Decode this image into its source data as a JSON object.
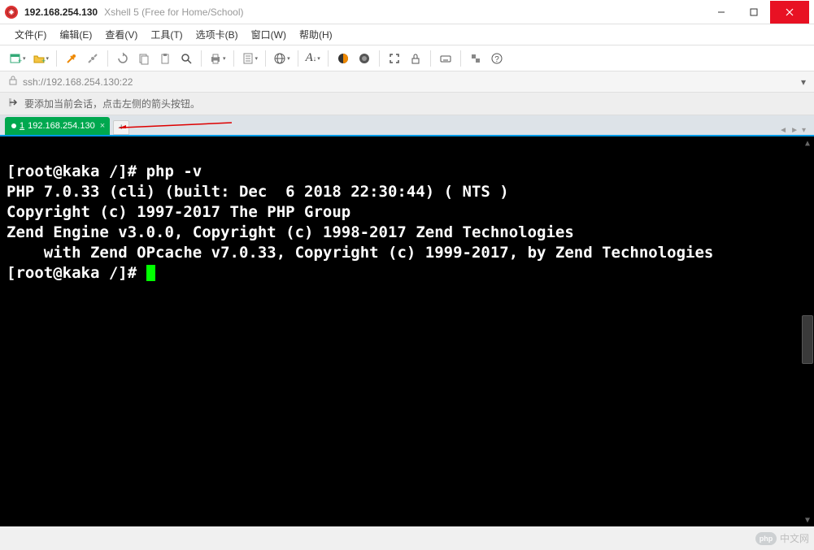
{
  "titlebar": {
    "host": "192.168.254.130",
    "app": "Xshell 5 (Free for Home/School)"
  },
  "menubar": [
    {
      "label": "文件(F)"
    },
    {
      "label": "编辑(E)"
    },
    {
      "label": "查看(V)"
    },
    {
      "label": "工具(T)"
    },
    {
      "label": "选项卡(B)"
    },
    {
      "label": "窗口(W)"
    },
    {
      "label": "帮助(H)"
    }
  ],
  "address": {
    "url": "ssh://192.168.254.130:22"
  },
  "hint": {
    "text": "要添加当前会话，点击左侧的箭头按钮。"
  },
  "tabs": {
    "items": [
      {
        "num": "1",
        "label": "192.168.254.130"
      }
    ]
  },
  "terminal": {
    "lines": [
      "[root@kaka /]# php -v",
      "PHP 7.0.33 (cli) (built: Dec  6 2018 22:30:44) ( NTS )",
      "Copyright (c) 1997-2017 The PHP Group",
      "Zend Engine v3.0.0, Copyright (c) 1998-2017 Zend Technologies",
      "    with Zend OPcache v7.0.33, Copyright (c) 1999-2017, by Zend Technologies",
      "[root@kaka /]# "
    ]
  },
  "watermark": {
    "badge": "php",
    "text": "中文网"
  }
}
